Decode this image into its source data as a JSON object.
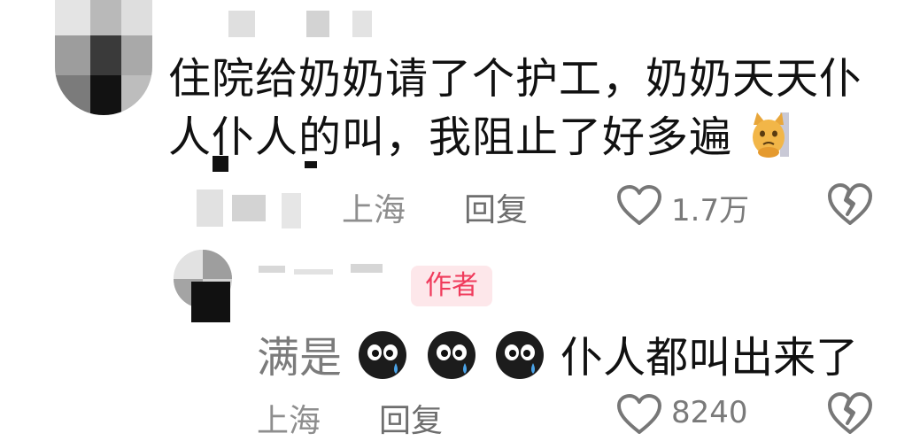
{
  "comment": {
    "text_line1": "住院给奶奶请了个护工，奶奶天天仆",
    "text_line2": "人仆人的叫，我阻止了好多遍",
    "emoji": "cat-icon",
    "location": "上海",
    "reply_label": "回复",
    "like_count": "1.7万"
  },
  "reply": {
    "author_badge": "作者",
    "text_prefix": "满是",
    "text_suffix": "仆人都叫出来了",
    "stickers": [
      "crying-face-icon",
      "crying-face-icon",
      "crying-face-icon"
    ],
    "location": "上海",
    "reply_label": "回复",
    "like_count": "8240"
  },
  "colors": {
    "badge_text": "#f03b5c",
    "badge_bg": "#fde7ea",
    "meta_gray": "#8e8e8e"
  }
}
